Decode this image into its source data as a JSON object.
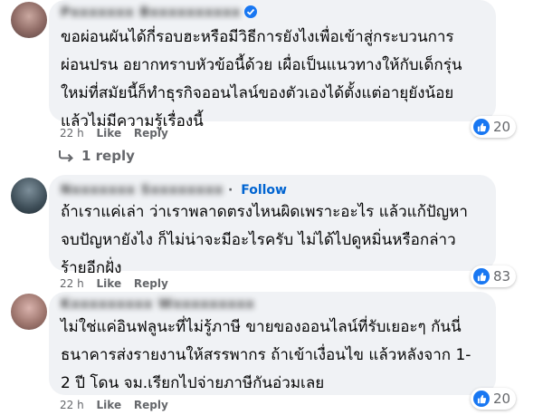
{
  "comments": [
    {
      "author": "Pxxxxxxx Bxxxxxxxxxx",
      "verified": true,
      "text": "ขอผ่อนผันได้กี่รอบฮะหรือมีวิธีการยังไงเพื่อเข้าสู่กระบวนการ\nผ่อนปรน อยากทราบหัวข้อนี้ด้วย เผื่อเป็นแนวทางให้กับเด็กรุ่น\nใหม่ที่สมัยนี้ก็ทำธุรกิจออนไลน์ของตัวเองได้ตั้งแต่อายุยังน้อย\nแล้วไม่มีความรู้เรื่องนี้",
      "time": "22 h",
      "like_label": "Like",
      "reply_label": "Reply",
      "reactions": "20",
      "replies_label": "1 reply"
    },
    {
      "author": "Nxxxxxxx Sxxxxxxxx",
      "follow_label": "Follow",
      "text": "ถ้าเราแค่เล่า ว่าเราพลาดตรงไหนผิดเพราะอะไร แล้วแก้ปัญหา\nจบปัญหายังไง ก็ไม่น่าจะมีอะไรครับ ไม่ได้ไปดูหมิ่นหรือกล่าว\nร้ายอีกฝั่ง",
      "time": "22 h",
      "like_label": "Like",
      "reply_label": "Reply",
      "reactions": "83"
    },
    {
      "author": "Kxxxxxxxxx Wxxxxxxxxx",
      "text": "ไม่ใช่แค่อินฟลูนะที่ไม่รู้ภาษี ขายของออนไลน์ที่รับเยอะๆ กันนี่\nธนาคารส่งรายงานให้สรรพากร ถ้าเข้าเงื่อนไข แล้วหลังจาก 1-\n2 ปี โดน จม.เรียกไปจ่ายภาษีกันอ่วมเลย",
      "time": "22 h",
      "like_label": "Like",
      "reply_label": "Reply",
      "reactions": "20"
    }
  ],
  "colors": {
    "bubble": "#f0f2f5",
    "like_blue": "#1877f2",
    "meta": "#65676b"
  },
  "icons": [
    "thumbs-up-icon",
    "verified-badge-icon",
    "reply-arrow-icon"
  ]
}
